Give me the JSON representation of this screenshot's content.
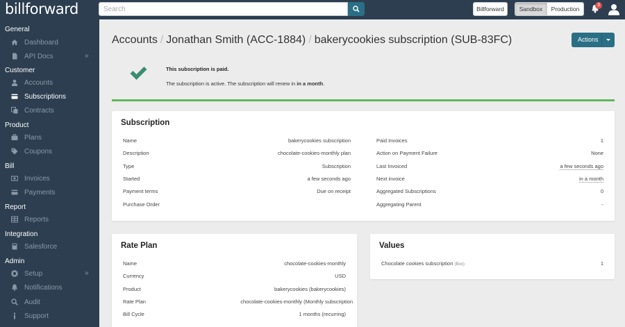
{
  "app": {
    "logo": "billforward"
  },
  "topbar": {
    "search_placeholder": "Search",
    "org_button": "Billforward",
    "env": {
      "sandbox": "Sandbox",
      "production": "Production"
    },
    "notification_count": "3"
  },
  "sidebar": {
    "general": "General",
    "dashboard": "Dashboard",
    "api_docs": "API Docs",
    "customer": "Customer",
    "accounts": "Accounts",
    "subscriptions": "Subscriptions",
    "contracts": "Contracts",
    "product": "Product",
    "plans": "Plans",
    "coupons": "Coupons",
    "bill": "Bill",
    "invoices": "Invoices",
    "payments": "Payments",
    "report": "Report",
    "reports": "Reports",
    "integration": "Integration",
    "salesforce": "Salesforce",
    "admin": "Admin",
    "setup": "Setup",
    "notifications": "Notifications",
    "audit": "Audit",
    "support": "Support"
  },
  "breadcrumb": {
    "accounts": "Accounts",
    "sep": "/",
    "account": "Jonathan Smith (ACC-1884)",
    "subscription": "bakerycookies subscription (SUB-83FC)"
  },
  "actions_label": "Actions",
  "status": {
    "title": "This subscription is paid.",
    "text_prefix": "The subscription is active. The subscription will renew in",
    "text_bold": "in a month",
    "text_suffix": "."
  },
  "subscription_panel": {
    "title": "Subscription",
    "left": {
      "name_label": "Name",
      "name_value": "bakerycookies subscription",
      "description_label": "Description",
      "description_value": "chocolate-cookies-monthly plan",
      "type_label": "Type",
      "type_value": "Subscription",
      "started_label": "Started",
      "started_value": "a few seconds ago",
      "payment_terms_label": "Payment terms",
      "payment_terms_value": "Due on receipt",
      "purchase_order_label": "Purchase Order"
    },
    "right": {
      "paid_invoices_label": "Paid Invoices",
      "paid_invoices_value": "1",
      "action_failure_label": "Action on Payment Failure",
      "action_failure_value": "None",
      "last_invoiced_label": "Last Invoiced",
      "last_invoiced_value": "a few seconds ago",
      "next_invoice_label": "Next invoice",
      "next_invoice_value": "in a month",
      "aggregated_label": "Aggregated Subscriptions",
      "aggregated_value": "0",
      "aggregating_parent_label": "Aggregating Parent",
      "aggregating_parent_value": "-"
    }
  },
  "rate_plan_panel": {
    "title": "Rate Plan",
    "name_label": "Name",
    "name_value": "chocolate-cookies-monthly",
    "currency_label": "Currency",
    "currency_value": "USD",
    "product_label": "Product",
    "product_value": "bakerycookies (bakerycookies)",
    "rate_plan_label": "Rate Plan",
    "rate_plan_value": "chocolate-cookies-monthly (Monthly subscription",
    "bill_cycle_label": "Bill Cycle",
    "bill_cycle_value": "1 months (recurring)"
  },
  "values_panel": {
    "title": "Values",
    "item_label": "Chocolate cookies subscription",
    "item_unit": "(Box)",
    "item_value": "1"
  }
}
